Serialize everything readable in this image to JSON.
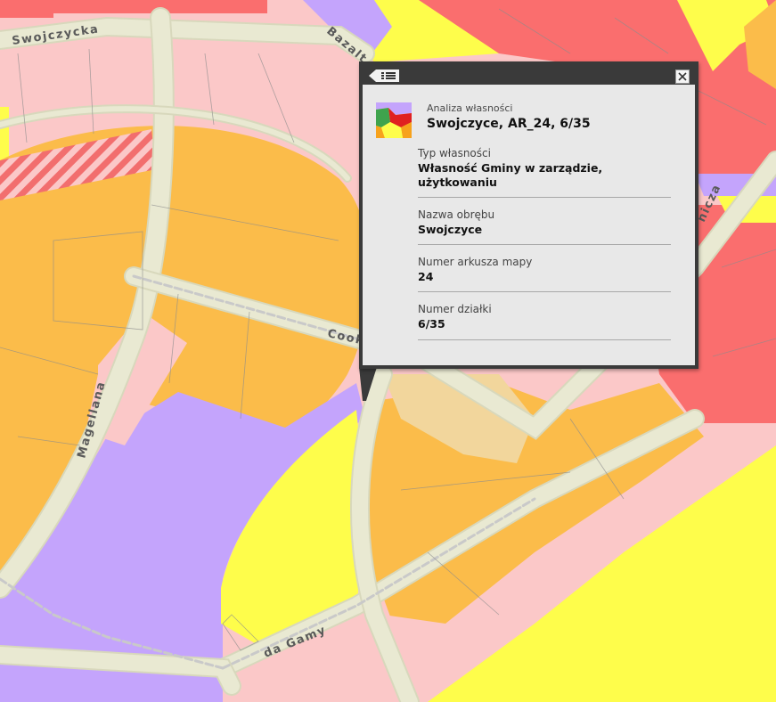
{
  "map": {
    "street_labels": {
      "swojczycka": "Swojczycka",
      "bazaltowa": "Bazalt",
      "magellana": "Magellana",
      "cook": "Cook",
      "gamy": "da Gamy",
      "right_street": "nicza"
    },
    "colors": {
      "orange": "#fbbc4a",
      "pink": "#fbc8c8",
      "red": "#fa6e6e",
      "yellow": "#fefd4b",
      "purple": "#c4a4fc",
      "road": "#e5e5cc",
      "beige": "#f2d69c",
      "hatch": "#f26e6e"
    }
  },
  "popup": {
    "menu_icon": "list-menu-icon",
    "close_icon": "close-icon",
    "layer_icon": "ownership-layer-icon",
    "subtitle": "Analiza własności",
    "title": "Swojczyce, AR_24, 6/35",
    "fields": [
      {
        "label": "Typ własności",
        "value": "Własność Gminy w zarządzie, użytkowaniu"
      },
      {
        "label": "Nazwa obrębu",
        "value": "Swojczyce"
      },
      {
        "label": "Numer arkusza mapy",
        "value": "24"
      },
      {
        "label": "Numer działki",
        "value": "6/35"
      }
    ]
  }
}
